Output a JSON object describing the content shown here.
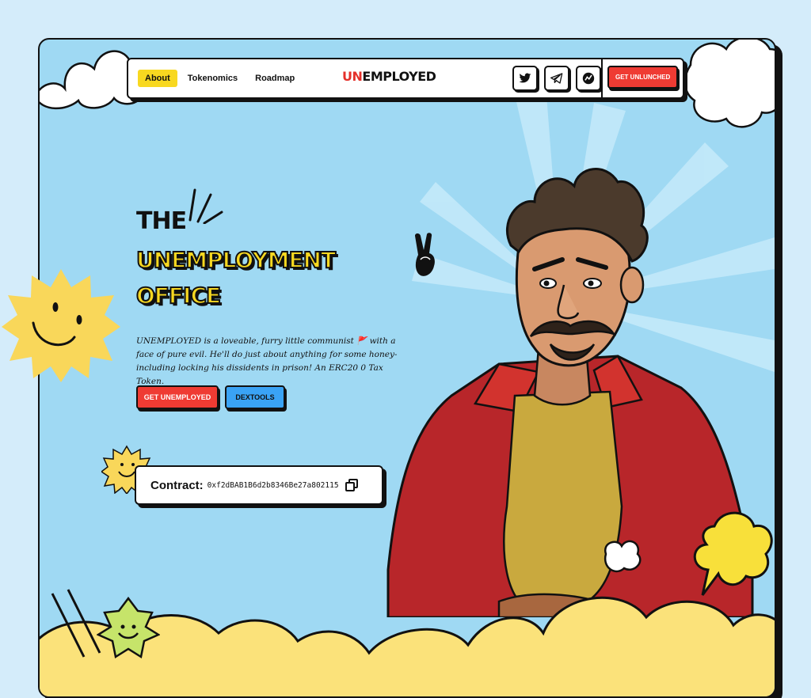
{
  "nav": {
    "items": [
      {
        "label": "About",
        "active": true
      },
      {
        "label": "Tokenomics",
        "active": false
      },
      {
        "label": "Roadmap",
        "active": false
      }
    ],
    "logo": {
      "red": "UN",
      "dark": "EMPLOYED"
    },
    "socials": [
      "twitter-icon",
      "telegram-icon",
      "dextools-icon"
    ],
    "cta": "GET UNLUNCHED"
  },
  "hero": {
    "line1": "THE",
    "line2": "UNEMPLOYMENT",
    "line3": "OFFICE",
    "description": "UNEMPLOYED is a loveable, furry little communist 🚩 with a face of pure evil. He'll do just about anything for some honey-including locking his dissidents in prison! An ERC20 0 Tax Token.",
    "primary_button": "GET UNEMPLOYED",
    "secondary_button": "DEXTOOLS"
  },
  "contract": {
    "label": "Contract:",
    "address": "0xf2dBAB1B6d2b8346Be27a802115"
  },
  "colors": {
    "background": "#d4ecfa",
    "sky": "#9fd9f3",
    "yellow": "#f8d820",
    "red": "#ef3b33",
    "blue": "#3aa3f5"
  }
}
